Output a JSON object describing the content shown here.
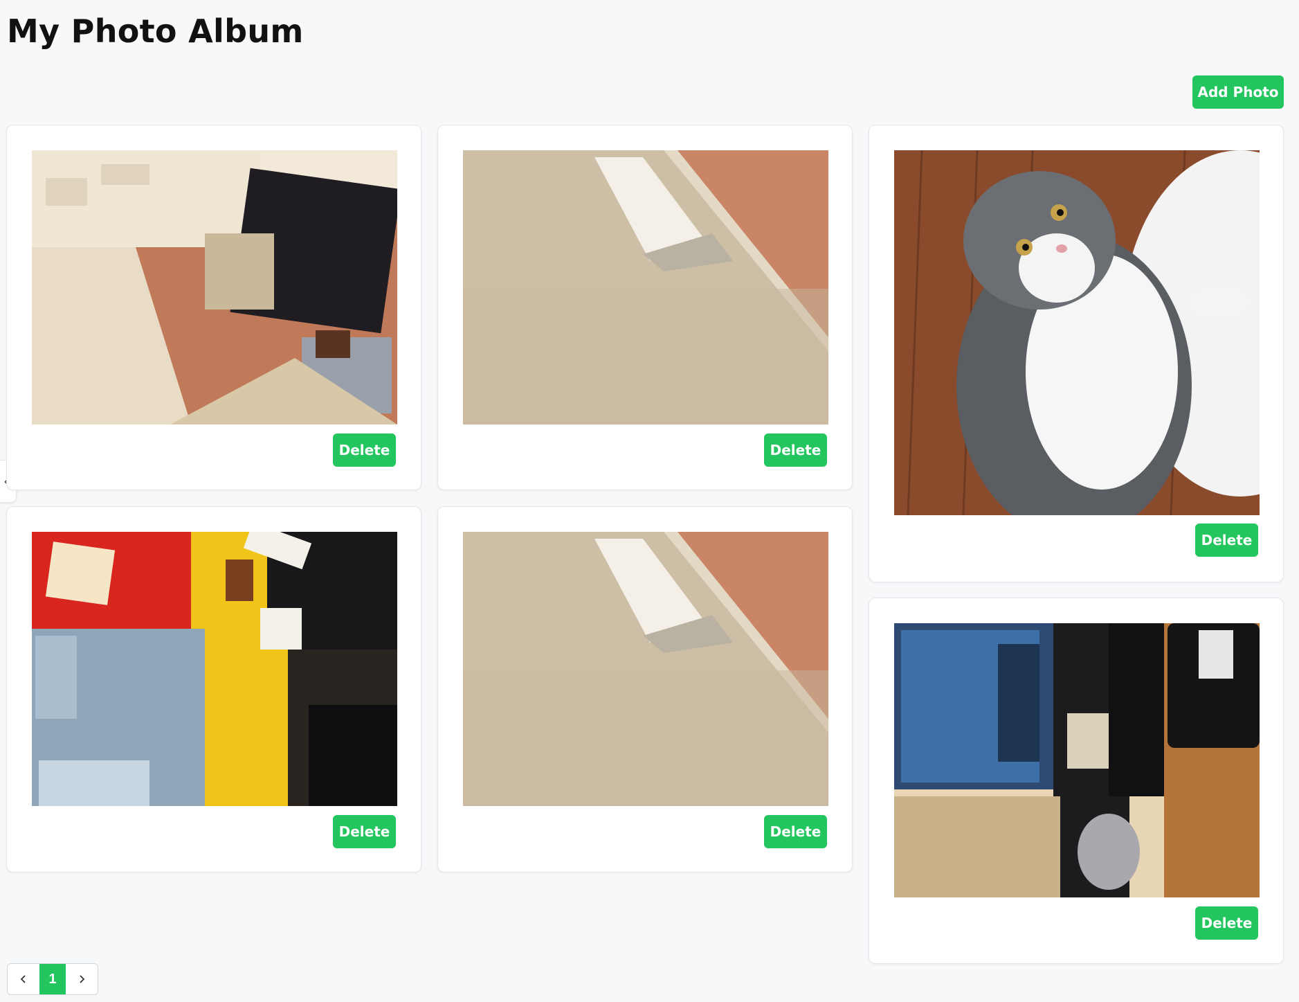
{
  "page": {
    "title": "My Photo Album"
  },
  "toolbar": {
    "add_label": "Add Photo"
  },
  "colors": {
    "accent": "#22c55e",
    "background": "#f7f8fa"
  },
  "photos": [
    {
      "subject": "room-with-suitcase",
      "delete_label": "Delete"
    },
    {
      "subject": "towel-on-beige-surface",
      "delete_label": "Delete"
    },
    {
      "subject": "grey-white-cat",
      "delete_label": "Delete"
    },
    {
      "subject": "cluttered-desk-with-monitor",
      "delete_label": "Delete"
    },
    {
      "subject": "towel-on-beige-surface",
      "delete_label": "Delete"
    },
    {
      "subject": "monitor-and-desk-setup",
      "delete_label": "Delete"
    }
  ],
  "pagination": {
    "current": "1",
    "prev_icon": "chevron-left-icon",
    "next_icon": "chevron-right-icon"
  },
  "side_tab": {
    "icon": "chevron-left-icon"
  }
}
